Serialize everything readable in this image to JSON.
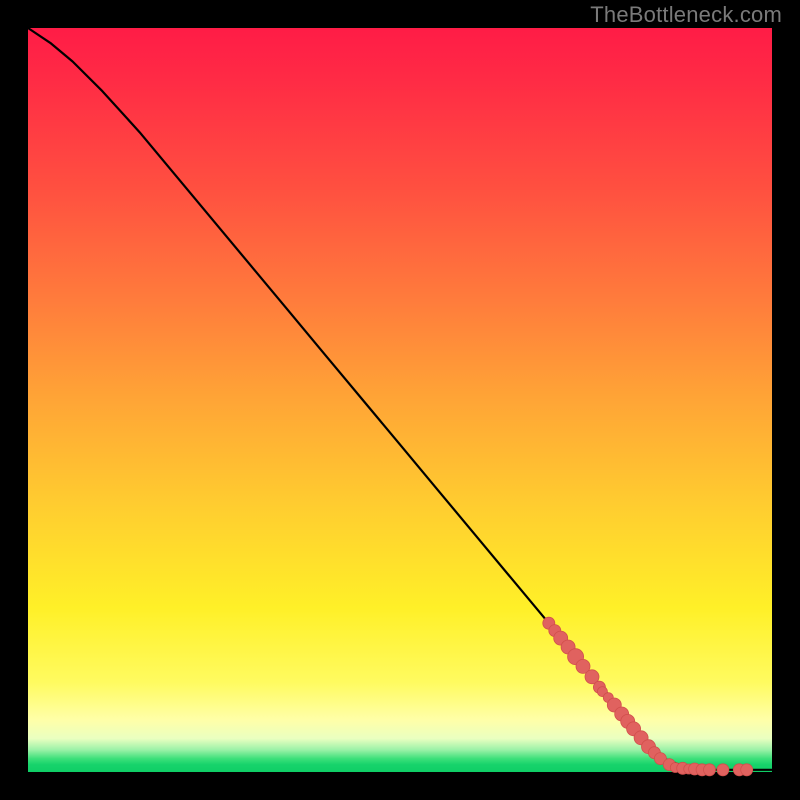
{
  "attribution": "TheBottleneck.com",
  "colors": {
    "dot_fill": "#e0625f",
    "dot_stroke": "#d14f4c",
    "curve_stroke": "#000000"
  },
  "chart_data": {
    "type": "line",
    "title": "",
    "xlabel": "",
    "ylabel": "",
    "xlim": [
      0,
      100
    ],
    "ylim": [
      0,
      100
    ],
    "grid": false,
    "legend": false,
    "series": [
      {
        "name": "curve",
        "x": [
          0,
          3,
          6,
          10,
          15,
          20,
          25,
          30,
          35,
          40,
          45,
          50,
          55,
          60,
          65,
          70,
          75,
          80,
          83,
          85,
          88,
          90,
          92,
          95,
          100
        ],
        "y": [
          100,
          98,
          95.5,
          91.5,
          86,
          80,
          74,
          68,
          62,
          56,
          50,
          44,
          38,
          32,
          26,
          20,
          14,
          8,
          4,
          2,
          0.8,
          0.4,
          0.3,
          0.3,
          0.3
        ]
      }
    ],
    "scatter_points": [
      {
        "x": 70.0,
        "y": 20.0,
        "r": 6
      },
      {
        "x": 70.8,
        "y": 19.0,
        "r": 6
      },
      {
        "x": 71.6,
        "y": 18.0,
        "r": 7
      },
      {
        "x": 72.6,
        "y": 16.8,
        "r": 7
      },
      {
        "x": 73.6,
        "y": 15.5,
        "r": 8
      },
      {
        "x": 74.6,
        "y": 14.2,
        "r": 7
      },
      {
        "x": 75.8,
        "y": 12.8,
        "r": 7
      },
      {
        "x": 76.8,
        "y": 11.4,
        "r": 6
      },
      {
        "x": 77.2,
        "y": 10.8,
        "r": 5
      },
      {
        "x": 78.0,
        "y": 10.0,
        "r": 5
      },
      {
        "x": 78.8,
        "y": 9.0,
        "r": 7
      },
      {
        "x": 79.8,
        "y": 7.8,
        "r": 7
      },
      {
        "x": 80.6,
        "y": 6.8,
        "r": 7
      },
      {
        "x": 81.4,
        "y": 5.8,
        "r": 7
      },
      {
        "x": 82.4,
        "y": 4.6,
        "r": 7
      },
      {
        "x": 83.4,
        "y": 3.4,
        "r": 7
      },
      {
        "x": 84.2,
        "y": 2.6,
        "r": 6
      },
      {
        "x": 85.0,
        "y": 1.8,
        "r": 6
      },
      {
        "x": 86.2,
        "y": 1.0,
        "r": 6
      },
      {
        "x": 87.0,
        "y": 0.6,
        "r": 5
      },
      {
        "x": 88.0,
        "y": 0.5,
        "r": 6
      },
      {
        "x": 88.8,
        "y": 0.4,
        "r": 5
      },
      {
        "x": 89.6,
        "y": 0.4,
        "r": 6
      },
      {
        "x": 90.6,
        "y": 0.3,
        "r": 6
      },
      {
        "x": 91.6,
        "y": 0.3,
        "r": 6
      },
      {
        "x": 93.4,
        "y": 0.3,
        "r": 6
      },
      {
        "x": 95.6,
        "y": 0.3,
        "r": 6
      },
      {
        "x": 96.6,
        "y": 0.3,
        "r": 6
      }
    ]
  }
}
